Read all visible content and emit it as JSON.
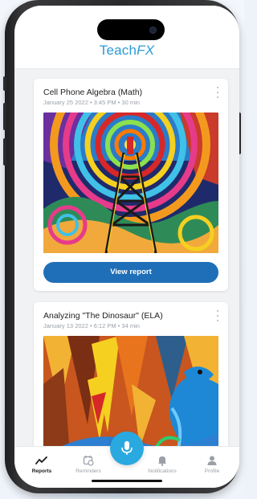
{
  "app": {
    "logo_text": "Teach",
    "logo_accent": "FX",
    "brand_color": "#2c9bd6"
  },
  "reports": [
    {
      "title": "Cell Phone Algebra (Math)",
      "meta": "January 25 2022 • 3:45 PM • 30 min",
      "image": "colorful-radio-tower-painting",
      "button_label": "View report"
    },
    {
      "title": "Analyzing \"The Dinosaur\" (ELA)",
      "meta": "January 13 2022 • 6:12 PM • 34 min",
      "image": "colorful-dinosaur-painting"
    }
  ],
  "tabbar": {
    "tabs": [
      {
        "label": "Reports",
        "icon": "activity-line-icon",
        "active": true
      },
      {
        "label": "Reminders",
        "icon": "calendar-clock-icon",
        "active": false
      },
      {
        "label": "Notifications",
        "icon": "bell-icon",
        "active": false
      },
      {
        "label": "Profile",
        "icon": "person-icon",
        "active": false
      }
    ],
    "record_icon": "microphone-icon",
    "accent_color": "#2aa9e0",
    "button_color": "#1e6fb8"
  }
}
